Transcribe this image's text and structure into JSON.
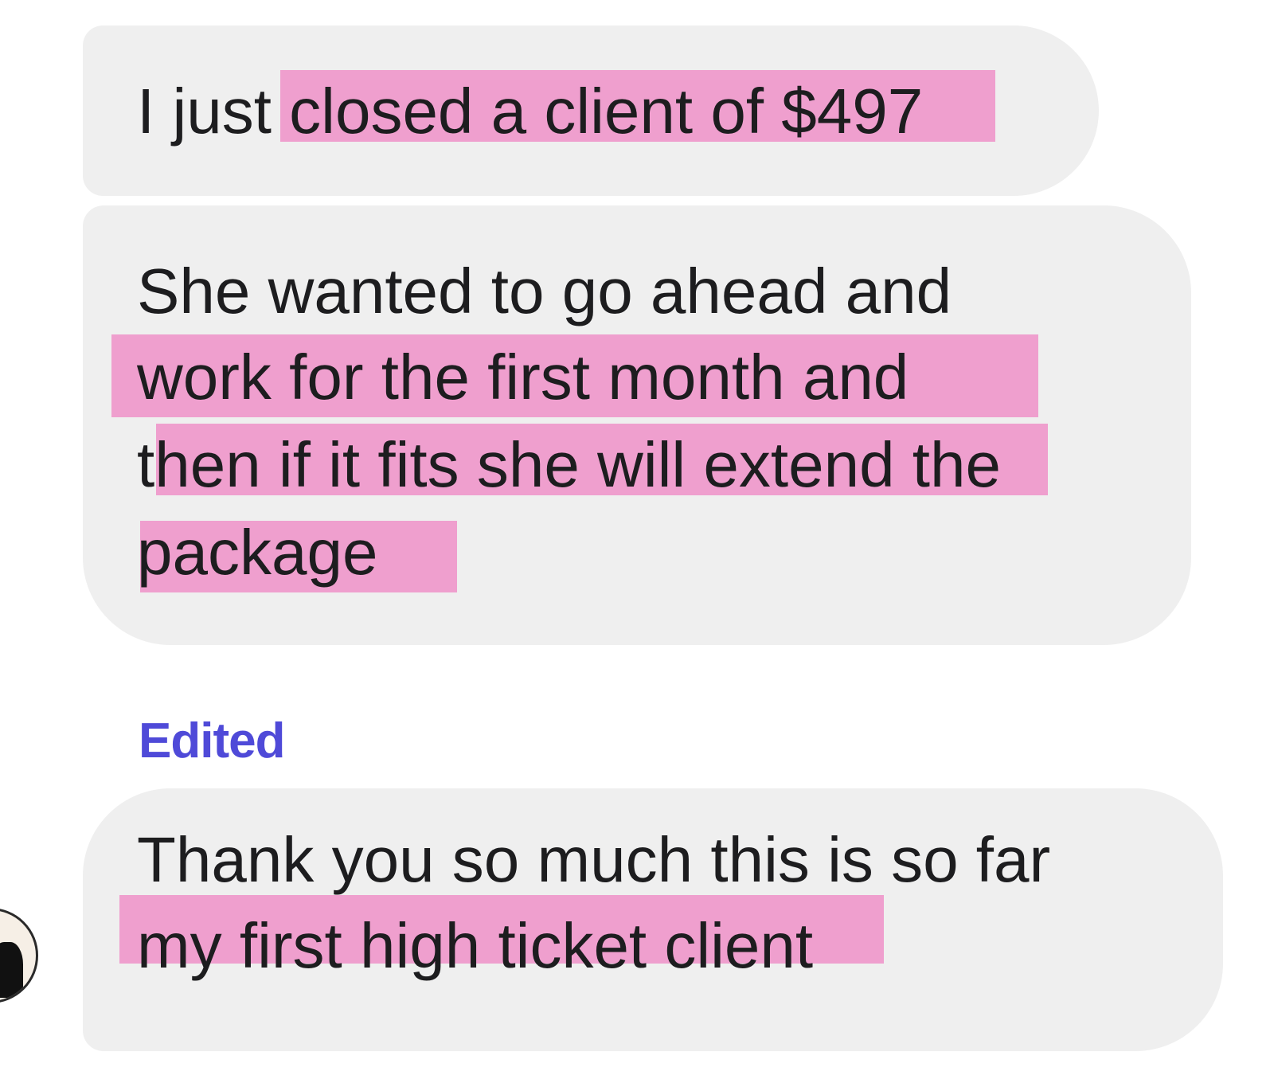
{
  "conversation": {
    "messages": [
      {
        "lines": [
          "I just closed a client of $497"
        ]
      },
      {
        "lines": [
          "She wanted to go ahead and",
          "work for the first month and",
          "then if it fits she will extend the",
          "package"
        ]
      },
      {
        "status": "Edited"
      },
      {
        "lines": [
          "Thank you so much this is so far",
          "my first high ticket client"
        ]
      }
    ],
    "highlight_color": "#ef9fce",
    "bubble_color": "#efefef",
    "edited_color": "#4f4ad8"
  }
}
